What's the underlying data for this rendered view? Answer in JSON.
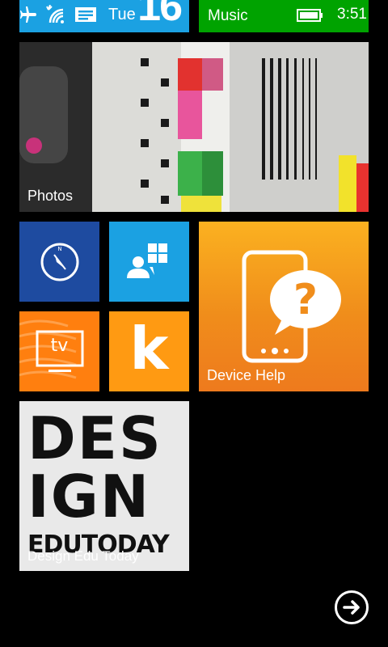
{
  "status": {
    "day": "Tue",
    "date": "16",
    "time": "3:51"
  },
  "tiles": {
    "music": "Music",
    "photos": "Photos",
    "device_help": "Device Help",
    "tv": "tv",
    "k": "k",
    "design": {
      "label": "Design Edu Today",
      "art_line1": "DES",
      "art_line2": "IGN",
      "art_line3": "EDUTODAY"
    }
  },
  "colors": {
    "accent_blue": "#1ba1e2",
    "music_green": "#00a300",
    "compass_blue": "#1e4ba0",
    "help_orange": "#f08d1b",
    "tv_orange": "#ff7f0f",
    "k_orange": "#ff9a12"
  },
  "icons": [
    "airplane-icon",
    "wifi-icon",
    "message-icon",
    "battery-icon",
    "compass-icon",
    "store-icon",
    "tv-icon",
    "device-help-icon",
    "arrow-right-icon"
  ]
}
